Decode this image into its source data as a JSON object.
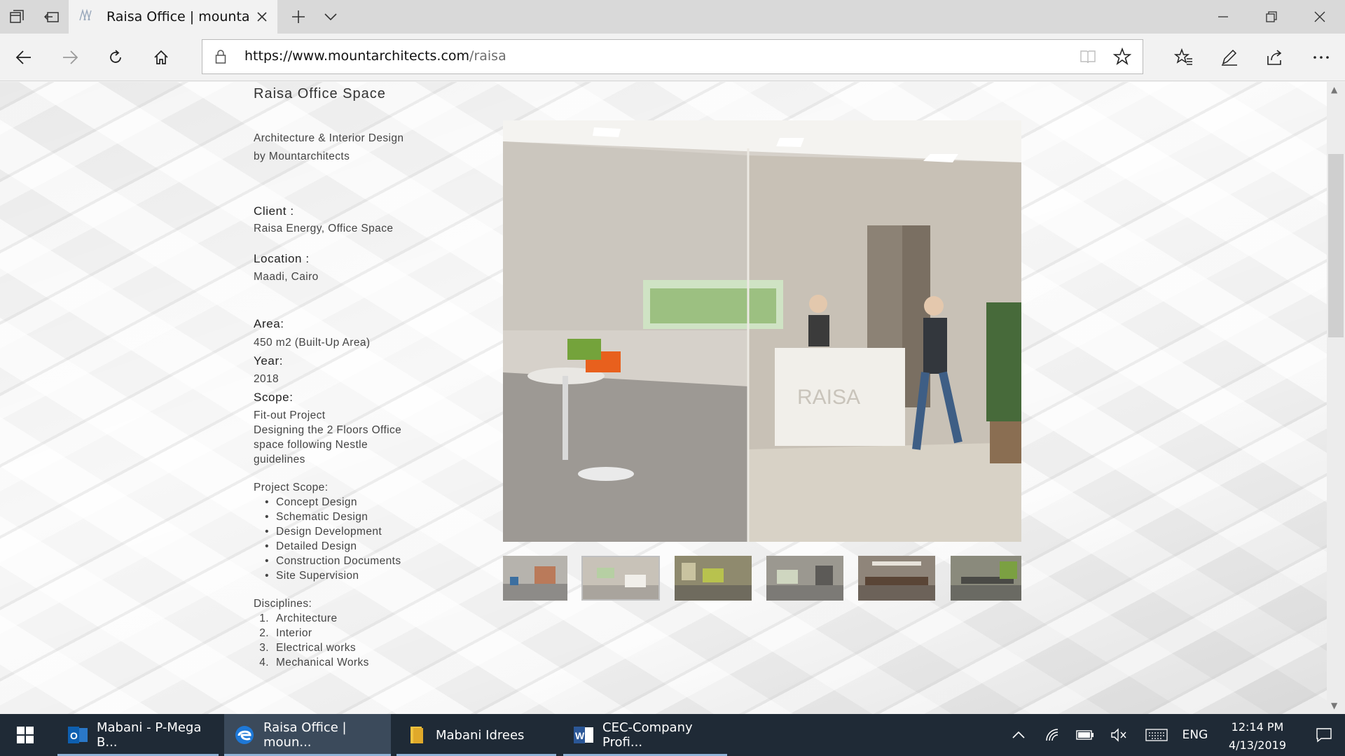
{
  "browser": {
    "tab_title": "Raisa Office | mountarcl",
    "url_main": "https://www.mountarchitects.com",
    "url_path": "/raisa"
  },
  "content": {
    "title": "Raisa Office Space",
    "subtitle_1": "Architecture & Interior Design",
    "subtitle_2": "by Mountarchitects",
    "client_label": "Client :",
    "client_value": "Raisa Energy, Office Space",
    "location_label": "Location :",
    "location_value": "Maadi, Cairo",
    "area_label": "Area:",
    "area_value": "450 m2 (Built-Up Area)",
    "year_label": "Year:",
    "year_value": "2018",
    "scope_label": "Scope:",
    "scope_lines": [
      "Fit-out Project",
      "Designing the 2 Floors Office",
      "space following Nestle",
      "guidelines"
    ],
    "project_scope_label": "Project Scope:",
    "project_scope_items": [
      "Concept Design",
      "Schematic Design",
      "Design Development",
      "Detailed Design",
      "Construction Documents",
      "Site Supervision"
    ],
    "disciplines_label": "Disciplines:",
    "disciplines_items": [
      "Architecture",
      "Interior",
      "Electrical works",
      "Mechanical Works"
    ],
    "image_sign_text": "RAISA"
  },
  "gallery": {
    "thumbnail_count": 6,
    "selected_index": 2
  },
  "taskbar": {
    "apps": [
      {
        "label": "Mabani - P-Mega B...",
        "icon": "outlook-icon"
      },
      {
        "label": "Raisa Office | moun...",
        "icon": "edge-icon"
      },
      {
        "label": "Mabani Idrees",
        "icon": "folder-icon"
      },
      {
        "label": "CEC-Company Profi...",
        "icon": "word-icon"
      }
    ],
    "language": "ENG",
    "time": "12:14 PM",
    "date": "4/13/2019"
  },
  "colors": {
    "taskbar": "#1f2a36",
    "tab_strip": "#d9d9d9",
    "accent": "#1e78d7"
  }
}
